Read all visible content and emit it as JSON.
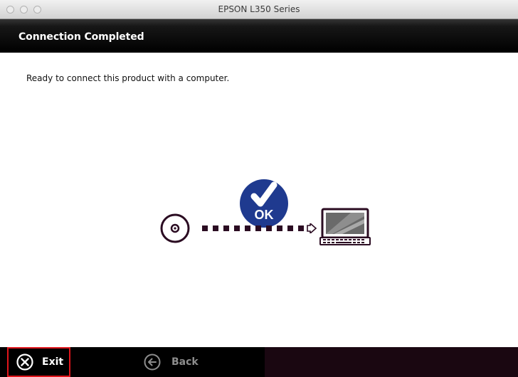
{
  "window": {
    "title": "EPSON L350 Series"
  },
  "header": {
    "title": "Connection Completed"
  },
  "main": {
    "message": "Ready to connect this product with a computer.",
    "badge_text": "OK"
  },
  "footer": {
    "exit_label": "Exit",
    "back_label": "Back"
  },
  "icons": {
    "cd": "cd-disc-icon",
    "ok": "ok-checkmark-icon",
    "laptop": "laptop-computer-icon",
    "exit": "close-circle-icon",
    "back": "back-arrow-circle-icon"
  },
  "colors": {
    "header_bg": "#000000",
    "footer_bg": "#1a0711",
    "ok_badge": "#1f3a8f",
    "exit_highlight": "#e0151b",
    "illustration_stroke": "#2b0c22"
  }
}
